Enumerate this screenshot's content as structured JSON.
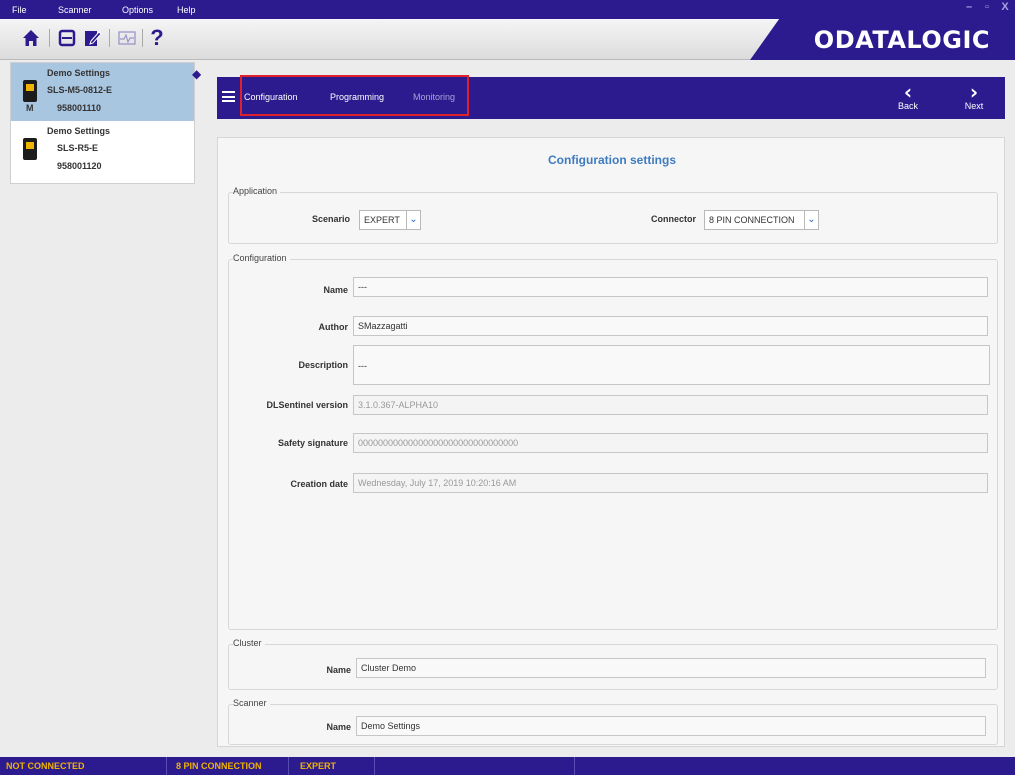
{
  "menu": {
    "file": "File",
    "scanner": "Scanner",
    "options": "Options",
    "help": "Help"
  },
  "window_controls": {
    "minimize": "–",
    "maximize": "▫",
    "close": "X"
  },
  "brand": {
    "logo": "ODATALOGIC",
    "color": "#2c1a8f"
  },
  "toolbar": {
    "icons": [
      "home-icon",
      "save-icon",
      "edit-document-icon",
      "monitor-icon",
      "help-icon"
    ],
    "help_glyph": "?"
  },
  "devices": [
    {
      "name": "Demo Settings",
      "model": "SLS-M5-0812-E",
      "badge": "M",
      "serial": "958001110",
      "selected": true
    },
    {
      "name": "Demo Settings",
      "model": "SLS-R5-E",
      "serial": "958001120",
      "selected": false
    }
  ],
  "nav": {
    "tabs": [
      {
        "label": "Configuration",
        "active": true
      },
      {
        "label": "Programming",
        "active": true
      },
      {
        "label": "Monitoring",
        "active": false
      }
    ],
    "back": "Back",
    "next": "Next"
  },
  "main": {
    "title": "Configuration settings",
    "application": {
      "label": "Application",
      "scenario_label": "Scenario",
      "scenario_value": "EXPERT",
      "connector_label": "Connector",
      "connector_value": "8 PIN CONNECTION"
    },
    "configuration": {
      "label": "Configuration",
      "name_label": "Name",
      "name_value": "---",
      "author_label": "Author",
      "author_value": "SMazzagatti",
      "description_label": "Description",
      "description_value": "---",
      "version_label": "DLSentinel version",
      "version_value": "3.1.0.367-ALPHA10",
      "signature_label": "Safety signature",
      "signature_value": "00000000000000000000000000000000",
      "date_label": "Creation date",
      "date_value": "Wednesday, July 17, 2019 10:20:16 AM"
    },
    "cluster": {
      "label": "Cluster",
      "name_label": "Name",
      "name_value": "Cluster Demo"
    },
    "scanner": {
      "label": "Scanner",
      "name_label": "Name",
      "name_value": "Demo Settings"
    }
  },
  "status": {
    "connection": "NOT CONNECTED",
    "connector": "8 PIN CONNECTION",
    "scenario": "EXPERT"
  },
  "colors": {
    "accent": "#2c1a8f",
    "title": "#3f7bbf",
    "status_text": "#f0b400",
    "highlight": "#e0202a"
  }
}
